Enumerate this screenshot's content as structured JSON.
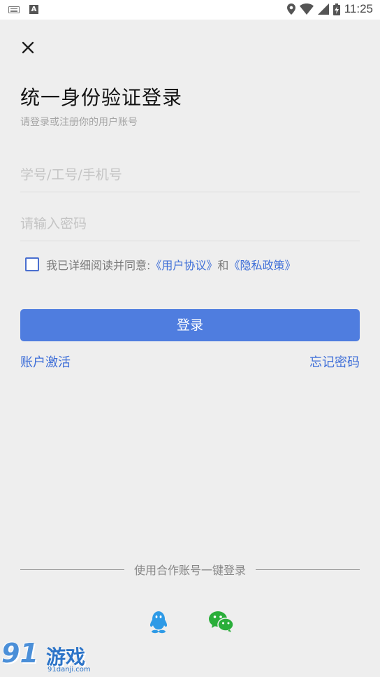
{
  "status_bar": {
    "time": "11:25",
    "left_icons": [
      "keyboard-icon",
      "a-icon"
    ],
    "right_icons": [
      "location-icon",
      "wifi-icon",
      "signal-icon",
      "battery-icon"
    ]
  },
  "header": {
    "close_icon": "close-icon",
    "title": "统一身份验证登录",
    "subtitle": "请登录或注册你的用户账号"
  },
  "form": {
    "username_placeholder": "学号/工号/手机号",
    "username_value": "",
    "password_placeholder": "请输入密码",
    "password_value": ""
  },
  "agreement": {
    "checked": false,
    "prefix": "我已详细阅读并同意:",
    "user_agreement": "《用户协议》",
    "and": "和",
    "privacy_policy": "《隐私政策》"
  },
  "actions": {
    "login_label": "登录",
    "activate_label": "账户激活",
    "forgot_label": "忘记密码"
  },
  "third_party": {
    "divider_text": "使用合作账号一键登录",
    "providers": [
      "qq-icon",
      "wechat-icon"
    ]
  },
  "watermark": {
    "number": "91",
    "text": "游戏",
    "url": "91danji.com"
  },
  "colors": {
    "accent": "#4f7ddf",
    "link": "#3f6fd8",
    "background": "#eeeeee",
    "qq": "#2e9ae6",
    "wechat": "#2aae3a"
  }
}
